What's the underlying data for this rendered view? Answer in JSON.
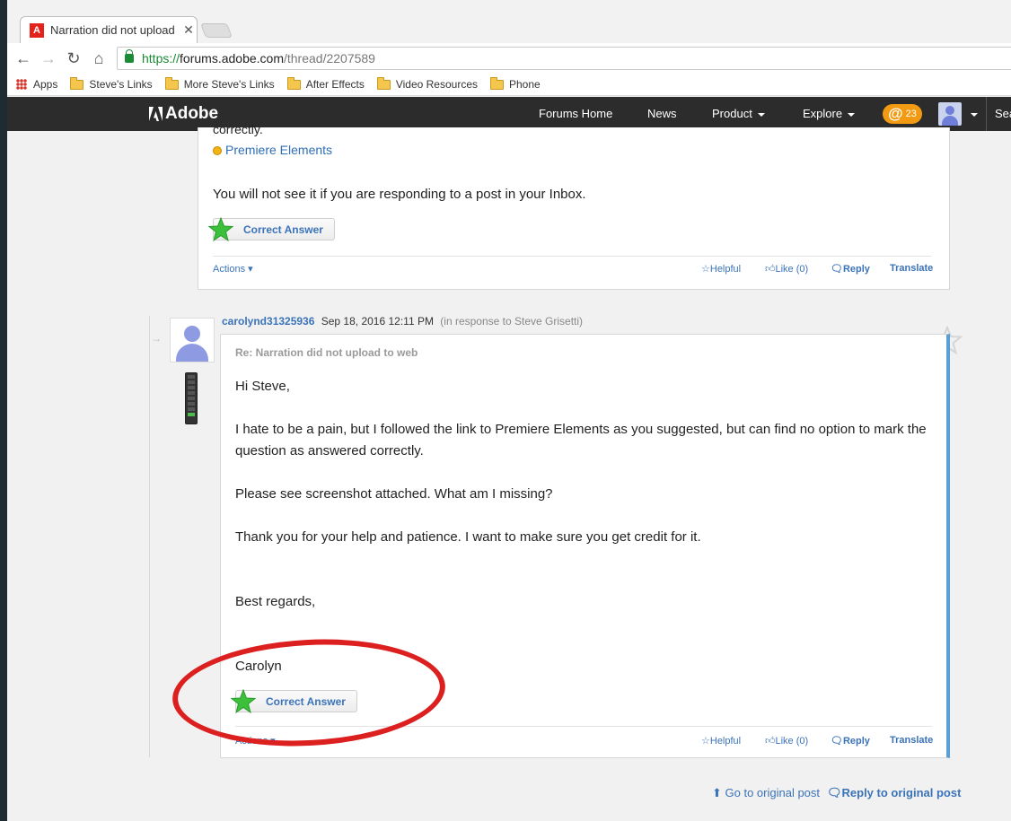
{
  "browser": {
    "tab_title": "Narration did not upload",
    "url_scheme": "https://",
    "url_host": "forums.adobe.com",
    "url_path": "/thread/2207589",
    "bookmarks": [
      "Apps",
      "Steve's Links",
      "More Steve's Links",
      "After Effects",
      "Video Resources",
      "Phone"
    ]
  },
  "header": {
    "logo": "Adobe",
    "nav": [
      "Forums Home",
      "News",
      "Product",
      "Explore"
    ],
    "mentions_count": "23",
    "search_label": "Search"
  },
  "post1": {
    "partial_text": "correctly.",
    "product_link": "Premiere Elements",
    "body": "You will not see it if you are responding to a post in your Inbox.",
    "correct_answer": "Correct Answer",
    "actions": "Actions",
    "helpful": "Helpful",
    "like": "Like (0)",
    "reply": "Reply",
    "translate": "Translate"
  },
  "post2": {
    "author": "carolynd31325936",
    "date": "Sep 18, 2016 12:11 PM",
    "in_response": "(in response to Steve Grisetti)",
    "subject": "Re: Narration did not upload to web",
    "greeting": "Hi Steve,",
    "para1_line1": "I hate to be a pain, but I followed the link to Premiere Elements as you suggested, but can find no option to mark the",
    "para1_line2": "question as answered correctly.",
    "para2": "Please see screenshot attached.  What am I missing?",
    "para3": "Thank you for your help and patience.  I want to make sure you get credit for it.",
    "closing": "Best regards,",
    "signature": "Carolyn",
    "correct_answer": "Correct Answer",
    "actions": "Actions",
    "helpful": "Helpful",
    "like": "Like (0)",
    "reply": "Reply",
    "translate": "Translate"
  },
  "footer": {
    "go_original": "Go to original post",
    "reply_original": "Reply to original post"
  },
  "colors": {
    "link": "#3b73b9",
    "header_bg": "#2c2c2c",
    "mentions_badge": "#f29a11",
    "highlight_circle": "#dc1f1f",
    "correct_star": "#3cc03c"
  }
}
